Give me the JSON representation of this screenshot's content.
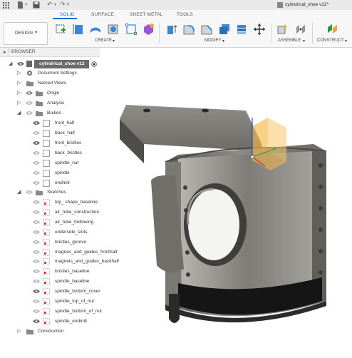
{
  "window": {
    "title": "cylindrical_shoe v12*"
  },
  "tabs": [
    "SOLID",
    "SURFACE",
    "SHEET METAL",
    "TOOLS"
  ],
  "workspace": {
    "label": "DESIGN"
  },
  "toolbar_groups": {
    "create": "CREATE",
    "modify": "MODIFY",
    "assemble": "ASSEMBLE",
    "construct": "CONSTRUCT"
  },
  "browser": {
    "title": "BROWSER",
    "root": "cylindrical_shoe v12",
    "document_settings": "Document Settings",
    "named_views": "Named Views",
    "origin": "Origin",
    "analysis": "Analysis",
    "bodies_label": "Bodies",
    "bodies": [
      "front_half",
      "back_half",
      "front_bristles",
      "back_bristles",
      "spindle_nut",
      "spindle",
      "endmill"
    ],
    "sketches_label": "Sketches",
    "sketches": [
      "top_ shape_baseline",
      "air_tube_construction",
      "air_tube_hollowing",
      "underside_slots",
      "bristles_groove",
      "magnes_and_guides_fronthalf",
      "magnets_and_guides_backhalf",
      "bristles_baseline",
      "spindle_baseline",
      "spindle_bottom_cover",
      "spindle_top_of_nut",
      "spindle_bottom_of_nut",
      "spindle_endmill"
    ],
    "construction": "Construction"
  },
  "colors": {
    "accent": "#1e6bd8",
    "model_gray": "#7a7a74",
    "plane_orange": "#f5b84a"
  }
}
